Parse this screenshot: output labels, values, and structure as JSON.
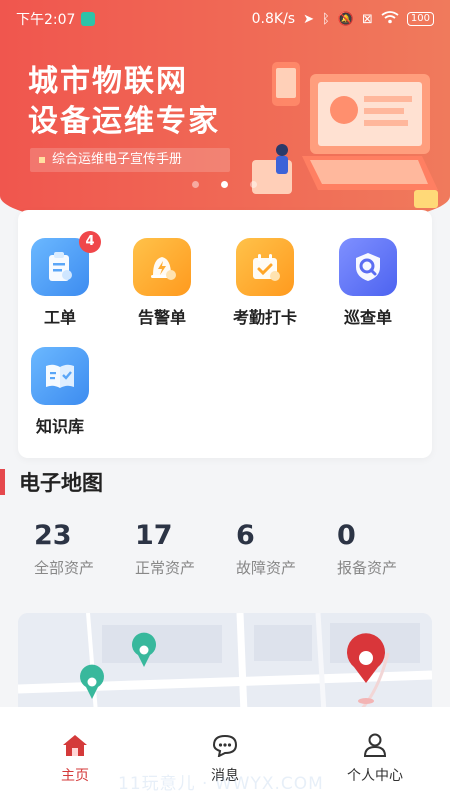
{
  "status_bar": {
    "time": "下午2:07",
    "network_speed": "0.8K/s",
    "battery": "100"
  },
  "banner": {
    "title_line1": "城市物联网",
    "title_line2": "设备运维专家",
    "subtitle": "综合运维电子宣传手册",
    "slide_count": 3,
    "active_slide": 2
  },
  "grid": {
    "items": [
      {
        "label": "工单",
        "badge": "4",
        "icon": "clipboard-icon"
      },
      {
        "label": "告警单",
        "icon": "alarm-icon"
      },
      {
        "label": "考勤打卡",
        "icon": "calendar-check-icon"
      },
      {
        "label": "巡查单",
        "icon": "shield-search-icon"
      },
      {
        "label": "知识库",
        "icon": "book-icon"
      }
    ]
  },
  "map_section": {
    "title": "电子地图",
    "stats": [
      {
        "value": "23",
        "label": "全部资产"
      },
      {
        "value": "17",
        "label": "正常资产"
      },
      {
        "value": "6",
        "label": "故障资产"
      },
      {
        "value": "0",
        "label": "报备资产"
      }
    ]
  },
  "tabbar": {
    "items": [
      {
        "label": "主页",
        "icon": "home-icon",
        "active": true
      },
      {
        "label": "消息",
        "icon": "message-icon"
      },
      {
        "label": "个人中心",
        "icon": "user-icon"
      }
    ]
  },
  "watermark": "11玩意儿 · WWYX.COM",
  "colors": {
    "accent": "#e5484d",
    "banner_start": "#f0564e",
    "banner_end": "#f07a5c",
    "badge": "#f0474a"
  }
}
